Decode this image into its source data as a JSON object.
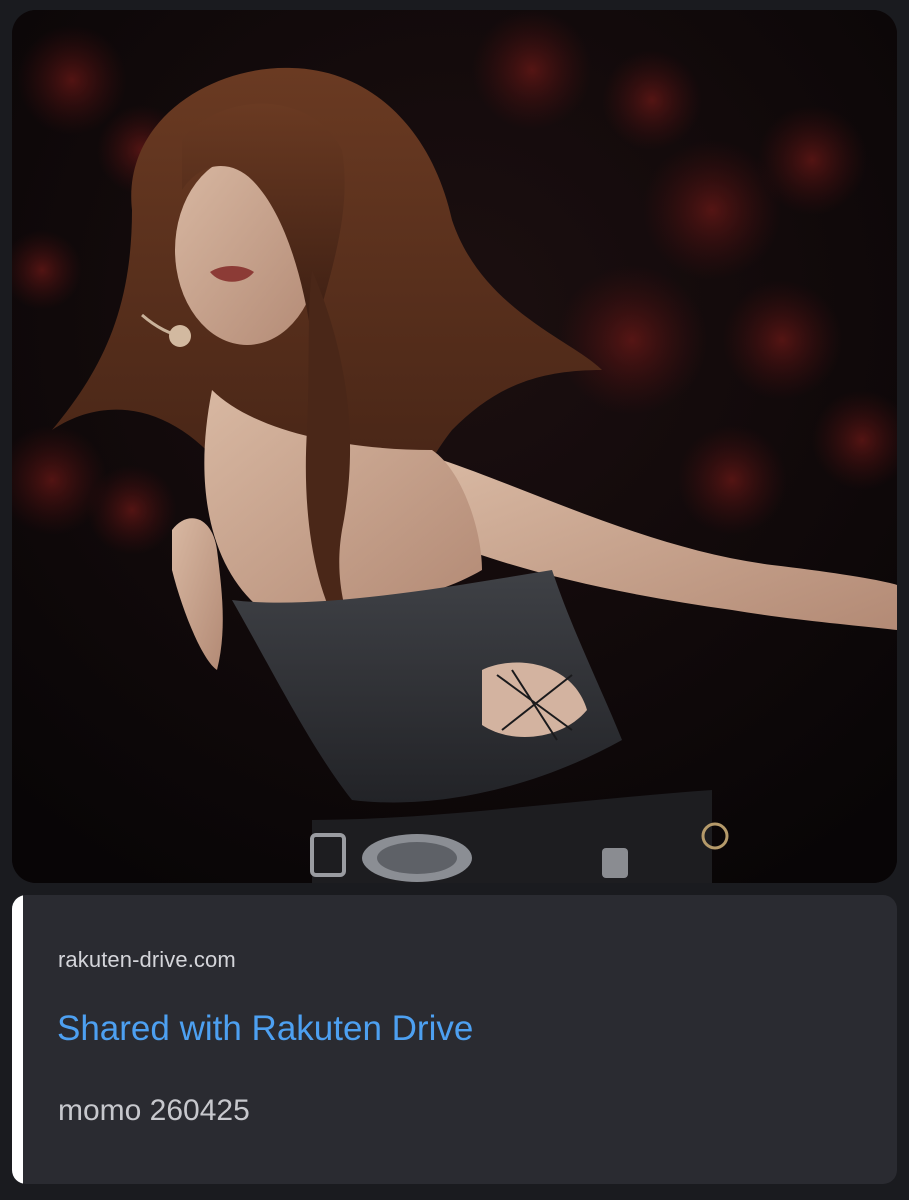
{
  "message": {
    "attachment": {
      "kind": "photo"
    },
    "embed": {
      "provider": "rakuten-drive.com",
      "title": "Shared with Rakuten Drive",
      "description": "momo 260425",
      "accent_color": "#ffffff",
      "title_color": "#4da0f1"
    }
  },
  "theme": {
    "background": "#1a1b1f",
    "card_background": "#2a2b31"
  }
}
